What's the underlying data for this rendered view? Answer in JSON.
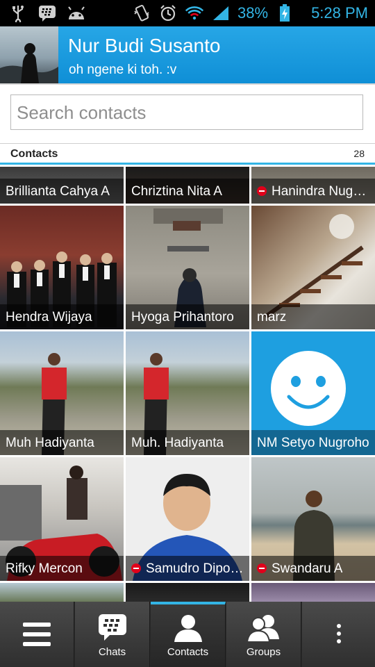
{
  "status_bar": {
    "battery": "38%",
    "time": "5:28 PM",
    "left_icons": [
      "usb-icon",
      "bbm-notification-icon",
      "android-icon"
    ],
    "right_icons": [
      "vibrate-icon",
      "alarm-icon",
      "wifi-icon",
      "signal-icon",
      "battery-charging-icon"
    ],
    "accent": "#33b5e5"
  },
  "profile": {
    "name": "Nur Budi Susanto",
    "status": "oh ngene ki toh. :v",
    "background": "#1e9fe0"
  },
  "search": {
    "placeholder": "Search contacts"
  },
  "contacts_section": {
    "title": "Contacts",
    "count": "28"
  },
  "contacts": [
    {
      "name": "Brillianta Cahya A",
      "busy": false
    },
    {
      "name": "Chriztina Nita A",
      "busy": false
    },
    {
      "name": "Hanindra Nugr…",
      "busy": true
    },
    {
      "name": "Hendra Wijaya",
      "busy": false
    },
    {
      "name": "Hyoga Prihantoro",
      "busy": false
    },
    {
      "name": "marz",
      "busy": false
    },
    {
      "name": "Muh Hadiyanta",
      "busy": false
    },
    {
      "name": "Muh. Hadiyanta",
      "busy": false
    },
    {
      "name": "NM Setyo Nugroho",
      "busy": false
    },
    {
      "name": "Rifky Mercon",
      "busy": false
    },
    {
      "name": "Samudro Dipo…",
      "busy": true
    },
    {
      "name": "Swandaru A",
      "busy": false
    }
  ],
  "bottom_nav": {
    "menu_icon": "hamburger-menu-icon",
    "items": [
      {
        "label": "Chats",
        "icon": "bbm-chat-icon"
      },
      {
        "label": "Contacts",
        "icon": "contact-icon"
      },
      {
        "label": "Groups",
        "icon": "groups-icon"
      }
    ],
    "overflow_icon": "overflow-menu-icon"
  }
}
